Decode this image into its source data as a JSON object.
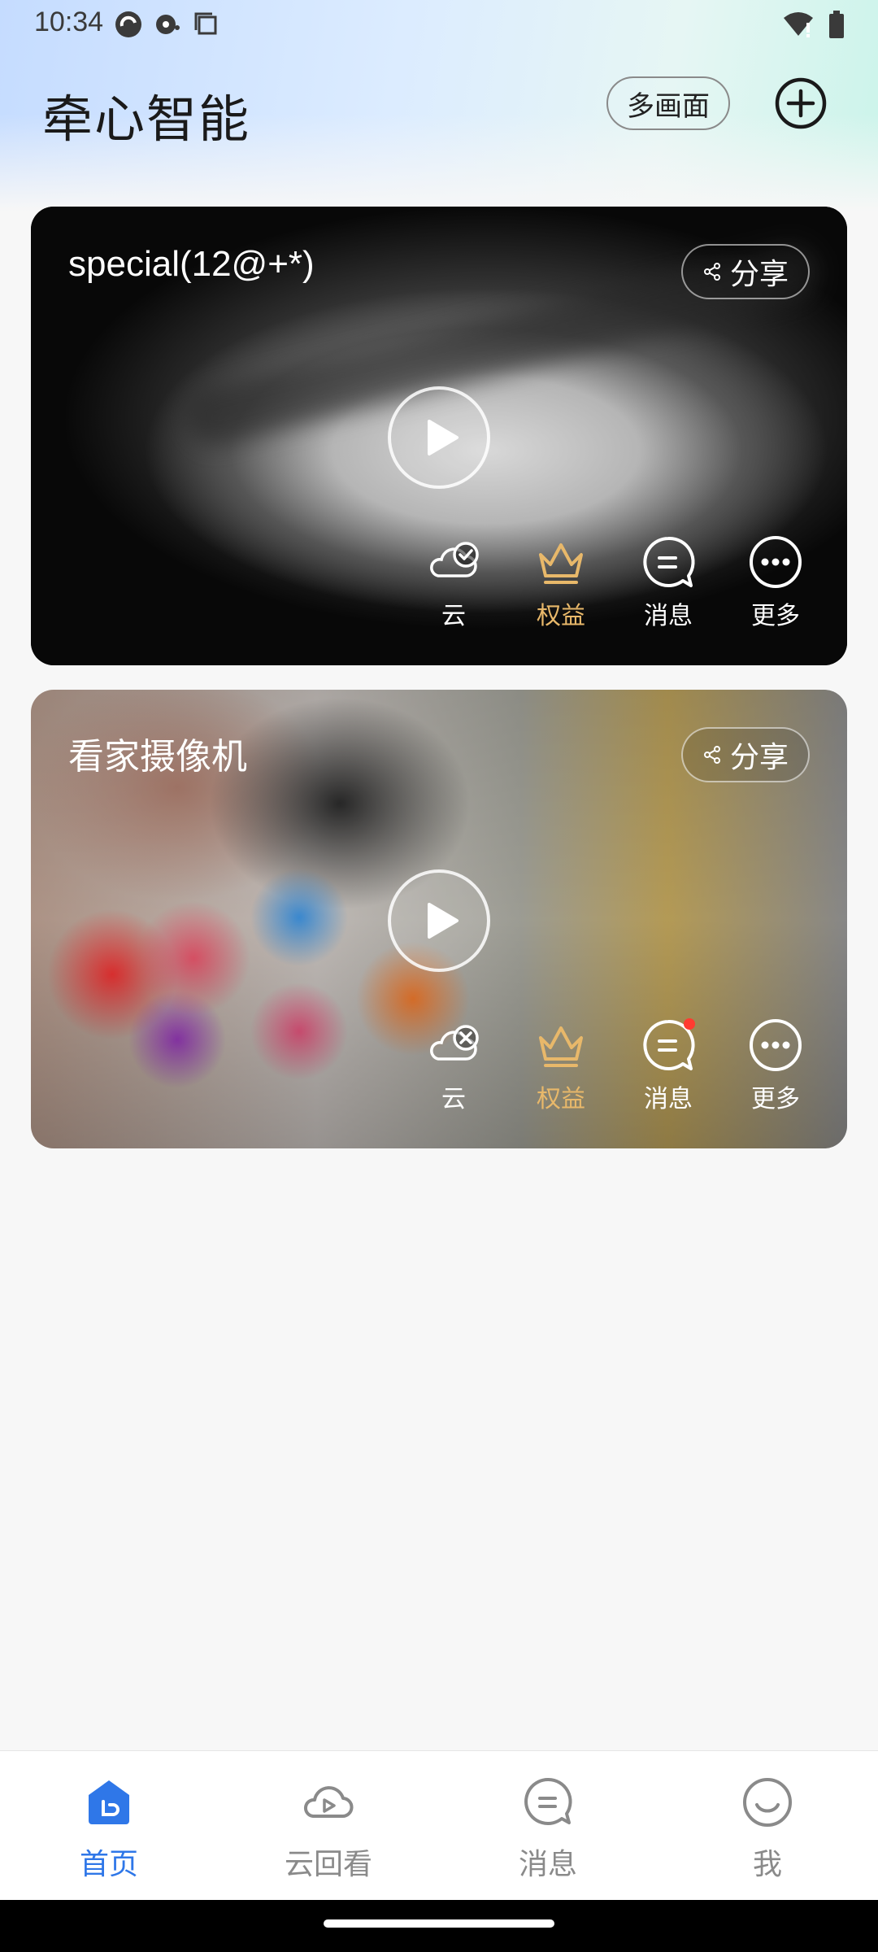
{
  "status_bar": {
    "time": "10:34"
  },
  "header": {
    "title": "牵心智能",
    "multi_view_label": "多画面"
  },
  "cameras": [
    {
      "name": "special(12@+*)",
      "share_label": "分享",
      "cloud_status": "enabled",
      "has_unread_message": false,
      "actions": {
        "cloud": "云",
        "benefits": "权益",
        "messages": "消息",
        "more": "更多"
      }
    },
    {
      "name": "看家摄像机",
      "share_label": "分享",
      "cloud_status": "disabled",
      "has_unread_message": true,
      "actions": {
        "cloud": "云",
        "benefits": "权益",
        "messages": "消息",
        "more": "更多"
      }
    }
  ],
  "bottom_nav": {
    "items": [
      {
        "label": "首页",
        "icon": "home-icon",
        "active": true
      },
      {
        "label": "云回看",
        "icon": "cloud-playback-icon",
        "active": false
      },
      {
        "label": "消息",
        "icon": "message-icon",
        "active": false
      },
      {
        "label": "我",
        "icon": "profile-icon",
        "active": false
      }
    ]
  },
  "colors": {
    "accent": "#2f77e8",
    "benefit_gold": "#e8b86a",
    "unread_dot": "#ff3b30"
  }
}
